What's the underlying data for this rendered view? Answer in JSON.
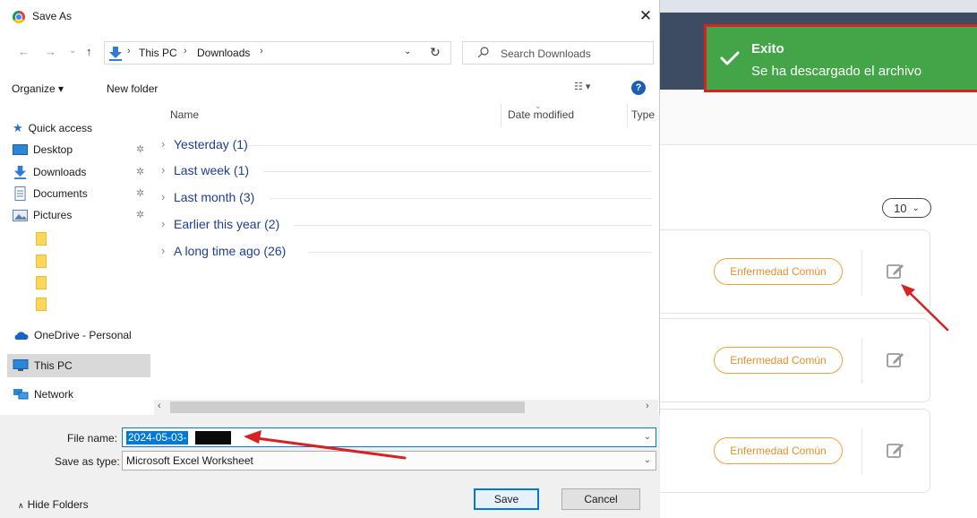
{
  "dialog": {
    "title": "Save As",
    "close_glyph": "✕",
    "nav": {
      "back": "←",
      "forward": "→",
      "recent": "⌄",
      "up": "↑"
    },
    "address": {
      "crumbs": [
        "This PC",
        "Downloads"
      ],
      "separator": "›"
    },
    "search_placeholder": "Search Downloads",
    "toolbar": {
      "organize": "Organize ▾",
      "new_folder": "New folder",
      "view": "☷ ▾",
      "help": "?"
    },
    "navpane": {
      "quick_access": "Quick access",
      "items": [
        {
          "label": "Desktop",
          "icon": "desktop-icon",
          "pinned": true
        },
        {
          "label": "Downloads",
          "icon": "downloads-icon",
          "pinned": true
        },
        {
          "label": "Documents",
          "icon": "documents-icon",
          "pinned": true
        },
        {
          "label": "Pictures",
          "icon": "pictures-icon",
          "pinned": true
        }
      ],
      "onedrive": "OneDrive - Personal",
      "this_pc": "This PC",
      "network": "Network",
      "pin_glyph": "✲"
    },
    "columns": {
      "name": "Name",
      "date_modified": "Date modified",
      "type": "Type"
    },
    "groups": [
      {
        "label": "Yesterday (1)"
      },
      {
        "label": "Last week (1)"
      },
      {
        "label": "Last month (3)"
      },
      {
        "label": "Earlier this year (2)"
      },
      {
        "label": "A long time ago (26)"
      }
    ],
    "file_name_label": "File name:",
    "file_name_value": "2024-05-03-",
    "save_as_type_label": "Save as type:",
    "save_as_type_value": "Microsoft Excel Worksheet",
    "hide_folders": "Hide Folders",
    "save_button": "Save",
    "cancel_button": "Cancel"
  },
  "background": {
    "per_page": "10",
    "cards": [
      {
        "badge": "Enfermedad Común"
      },
      {
        "badge": "Enfermedad Común"
      },
      {
        "badge": "Enfermedad Común"
      }
    ]
  },
  "toast": {
    "title": "Exito",
    "message": "Se ha descargado el archivo",
    "color": "#43a547"
  },
  "colors": {
    "accent": "#0078d7",
    "annotation": "#d62222",
    "badge": "#e6902c"
  }
}
